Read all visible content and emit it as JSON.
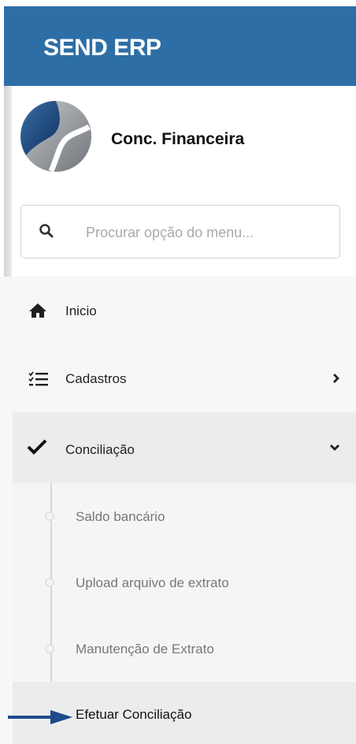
{
  "header": {
    "brand": "SEND ERP",
    "color": "#2e6ea6"
  },
  "profile": {
    "company": "Conc. Financeira",
    "logo_icon": "company-logo"
  },
  "search": {
    "icon": "search-icon",
    "placeholder": "Procurar opção do menu..."
  },
  "menu": {
    "items": [
      {
        "label": "Inicio",
        "icon": "home-icon"
      },
      {
        "label": "Cadastros",
        "icon": "checklist-icon",
        "chevron": "chevron-right-icon"
      },
      {
        "label": "Conciliação",
        "icon": "checkmark-icon",
        "chevron": "chevron-down-icon",
        "expanded": true
      }
    ],
    "submenu": [
      {
        "label": "Saldo bancário"
      },
      {
        "label": "Upload arquivo de extrato"
      },
      {
        "label": "Manutenção de Extrato"
      },
      {
        "label": "Efetuar Conciliação",
        "current": true,
        "annotation": "arrow-pointer"
      }
    ]
  }
}
